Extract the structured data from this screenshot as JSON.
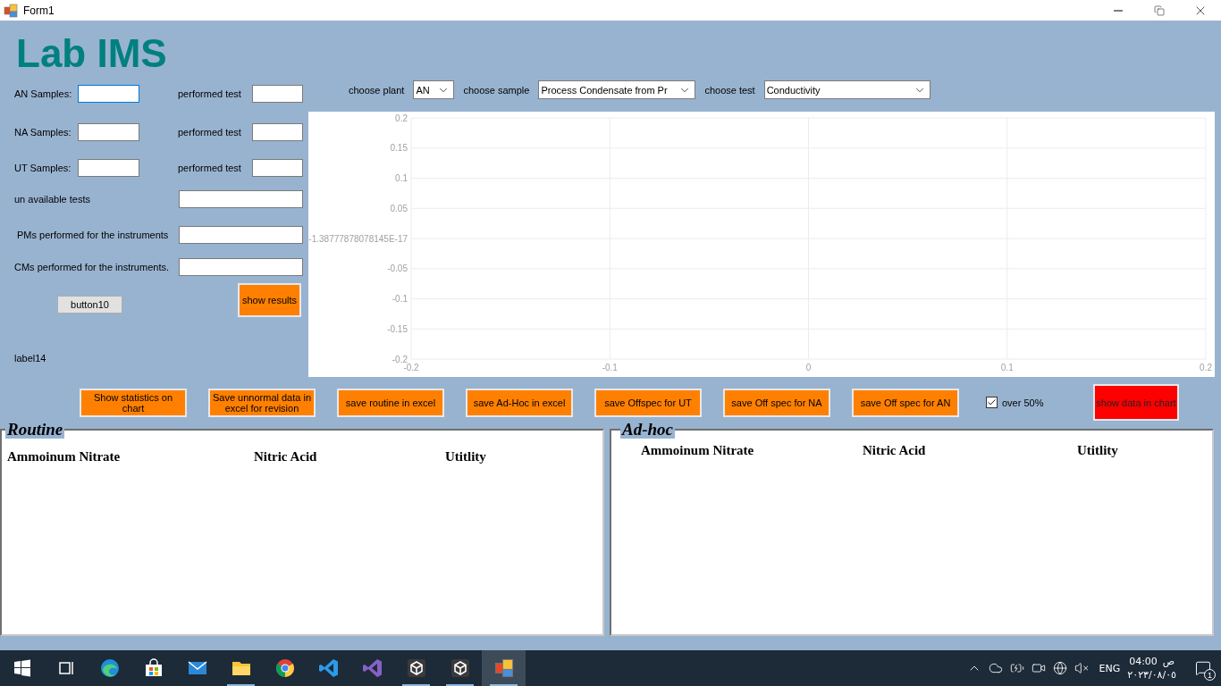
{
  "window": {
    "title": "Form1"
  },
  "app_title": "Lab IMS",
  "sample_fields": [
    {
      "label": "AN Samples:",
      "focused": true,
      "test_label": "performed test"
    },
    {
      "label": "NA Samples:",
      "focused": false,
      "test_label": "performed test"
    },
    {
      "label": "UT Samples:",
      "focused": false,
      "test_label": "performed test"
    }
  ],
  "text_fields": [
    {
      "label": "un available tests"
    },
    {
      "label": "PMs performed for the instruments"
    },
    {
      "label": "CMs performed for the instruments."
    }
  ],
  "left_buttons": [
    {
      "label": "button10",
      "kind": "plain"
    },
    {
      "label": "show results",
      "kind": "accent"
    }
  ],
  "status_label": "label14",
  "filters": [
    {
      "label": "choose plant",
      "value": "AN"
    },
    {
      "label": "choose sample",
      "value": "Process Condensate from Pr"
    },
    {
      "label": "choose test",
      "value": "Conductivity"
    }
  ],
  "chart": {
    "chart_data": {
      "type": "line",
      "grid": true,
      "xlim": [
        -0.2,
        0.2
      ],
      "ylim": [
        -0.2,
        0.2
      ],
      "xticks": [
        -0.2,
        -0.1,
        0,
        0.1,
        0.2
      ],
      "yticks": [
        0.2,
        0.15,
        0.1,
        0.05,
        {
          "value": 0,
          "label": "-1.38777878078145E-17"
        },
        -0.05,
        -0.1,
        -0.15,
        -0.2
      ]
    }
  },
  "actions": [
    {
      "kind": "button",
      "label": "Show statistics on chart"
    },
    {
      "kind": "button",
      "label": "Save unnormal data in excel for revision"
    },
    {
      "kind": "button",
      "label": "save routine in excel"
    },
    {
      "kind": "button",
      "label": "save Ad-Hoc in excel"
    },
    {
      "kind": "button",
      "label": "save Offspec for UT"
    },
    {
      "kind": "button",
      "label": "save Off spec for NA"
    },
    {
      "kind": "button",
      "label": "save Off spec for AN"
    },
    {
      "kind": "checkbox",
      "label": "over 50%",
      "checked": true
    },
    {
      "kind": "alert",
      "label": "show data in chart"
    }
  ],
  "panels": [
    {
      "title": "Routine",
      "columns": [
        "Ammoinum Nitrate",
        "Nitric Acid",
        "Utitlity"
      ]
    },
    {
      "title": "Ad-hoc",
      "columns": [
        "Ammoinum Nitrate",
        "Nitric Acid",
        "Utitlity"
      ]
    }
  ],
  "taskbar": {
    "apps": [
      {
        "kind": "start",
        "running": false,
        "selected": false
      },
      {
        "kind": "taskview",
        "running": false,
        "selected": false
      },
      {
        "kind": "edge",
        "running": false,
        "selected": false
      },
      {
        "kind": "store",
        "running": false,
        "selected": false
      },
      {
        "kind": "mail",
        "running": false,
        "selected": false
      },
      {
        "kind": "explorer",
        "running": true,
        "selected": false
      },
      {
        "kind": "chrome",
        "running": false,
        "selected": false
      },
      {
        "kind": "vscode",
        "running": false,
        "selected": false
      },
      {
        "kind": "vstudio",
        "running": false,
        "selected": false
      },
      {
        "kind": "unity",
        "running": true,
        "selected": false
      },
      {
        "kind": "unity",
        "running": true,
        "selected": false
      },
      {
        "kind": "form",
        "running": true,
        "selected": true
      }
    ],
    "language": "ENG",
    "time": "04:00",
    "period": "ص",
    "date": "٢٠٢٣/٠٨/٠٥",
    "notifications": "1"
  }
}
